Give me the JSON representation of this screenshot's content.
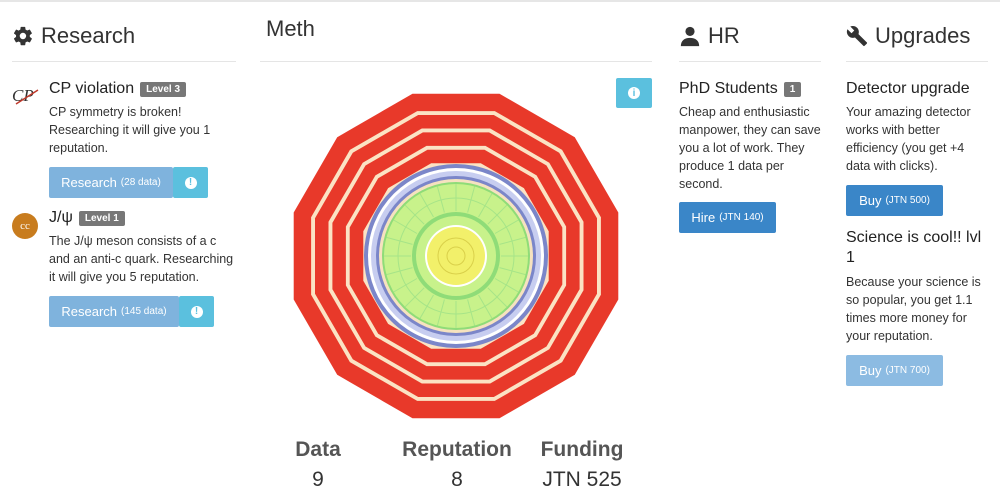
{
  "research": {
    "title": "Research",
    "items": [
      {
        "name": "CP violation",
        "level": "Level 3",
        "icon": "cp-icon",
        "description": "CP symmetry is broken! Researching it will give you 1 reputation.",
        "button_label": "Research",
        "button_cost": "(28 data)"
      },
      {
        "name": "J/ψ",
        "level": "Level 1",
        "icon": "charm-quark-icon",
        "icon_text": "cc",
        "description": "The J/ψ meson consists of a c and an anti-c quark. Researching it will give you 5 reputation.",
        "button_label": "Research",
        "button_cost": "(145 data)"
      }
    ]
  },
  "detector": {
    "title": "Meth",
    "info_icon": "info-icon"
  },
  "stats": {
    "data_label": "Data",
    "data_value": "9",
    "reputation_label": "Reputation",
    "reputation_value": "8",
    "funding_label": "Funding",
    "funding_value": "JTN 525"
  },
  "hr": {
    "title": "HR",
    "items": [
      {
        "name": "PhD Students",
        "count": "1",
        "description": "Cheap and enthusiastic manpower, they can save you a lot of work. They produce 1 data per second.",
        "button_label": "Hire",
        "button_cost": "(JTN 140)"
      }
    ]
  },
  "upgrades": {
    "title": "Upgrades",
    "items": [
      {
        "name": "Detector upgrade",
        "description": "Your amazing detector works with better efficiency (you get +4 data with clicks).",
        "button_label": "Buy",
        "button_cost": "(JTN 500)"
      },
      {
        "name": "Science is cool!! lvl 1",
        "description": "Because your science is so popular, you get 1.1 times more money for your reputation.",
        "button_label": "Buy",
        "button_cost": "(JTN 700)"
      }
    ]
  },
  "colors": {
    "red": "#e8392a",
    "cream": "#fbe3c4",
    "blue_ring": "#7b86c9",
    "light_blue": "#c7cdf0",
    "green": "#8fdc78",
    "light_green": "#c8f28b",
    "yellow": "#f2f06a",
    "button_blue": "#3a86c8",
    "info": "#5bc0de"
  }
}
